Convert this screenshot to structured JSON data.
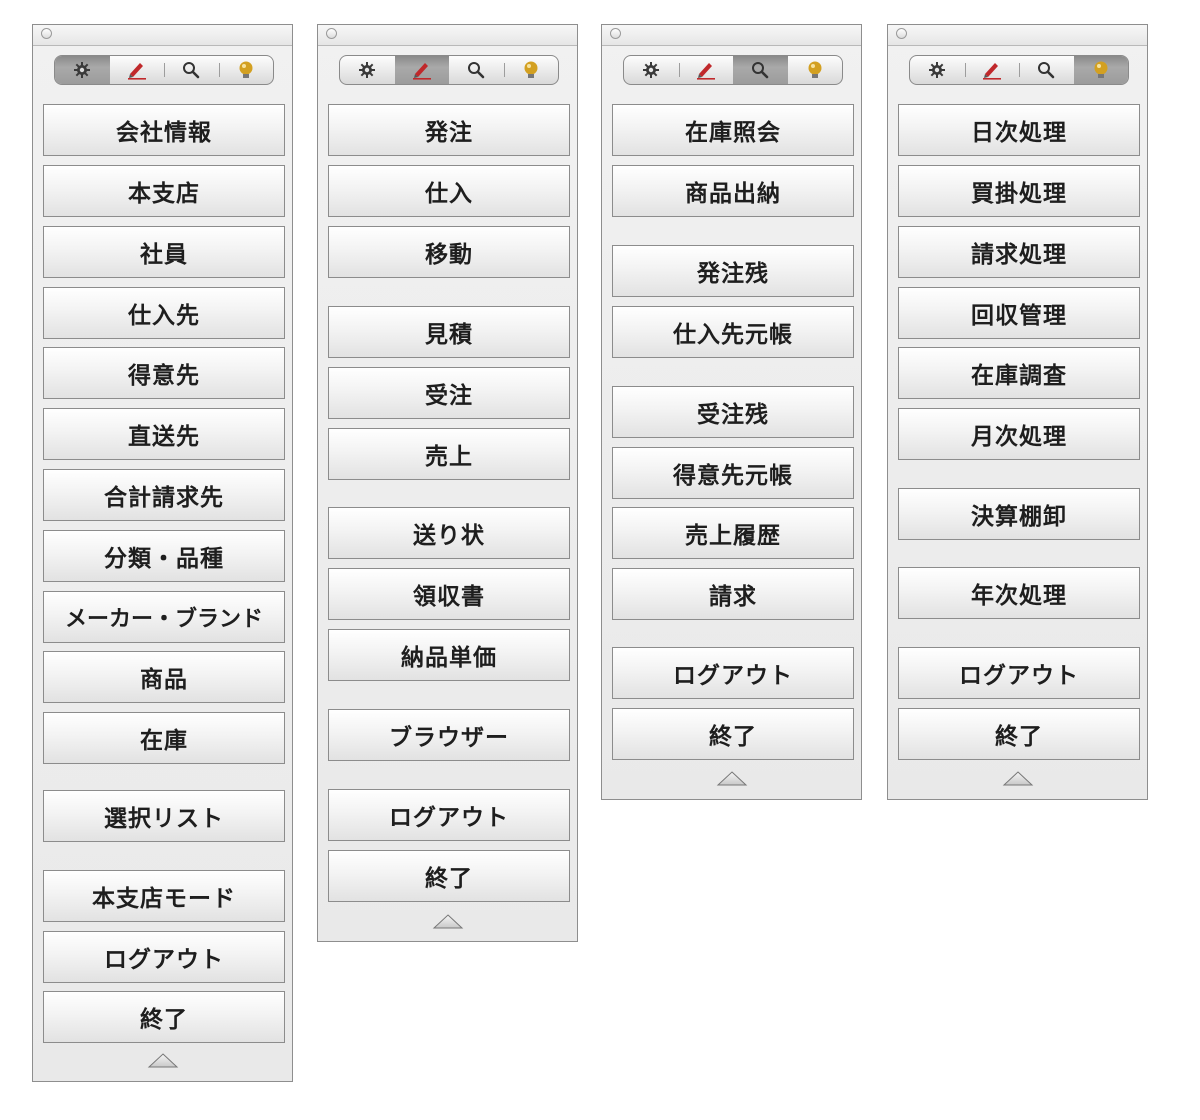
{
  "panels": [
    {
      "active_tab": "settings",
      "items": [
        "会社情報",
        "本支店",
        "社員",
        "仕入先",
        "得意先",
        "直送先",
        "合計請求先",
        "分類・品種",
        "メーカー・ブランド",
        "商品",
        "在庫",
        "選択リスト",
        "本支店モード",
        "ログアウト",
        "終了"
      ]
    },
    {
      "active_tab": "edit",
      "items": [
        "発注",
        "仕入",
        "移動",
        "見積",
        "受注",
        "売上",
        "送り状",
        "領収書",
        "納品単価",
        "ブラウザー",
        "ログアウト",
        "終了"
      ]
    },
    {
      "active_tab": "search",
      "items": [
        "在庫照会",
        "商品出納",
        "発注残",
        "仕入先元帳",
        "受注残",
        "得意先元帳",
        "売上履歴",
        "請求",
        "ログアウト",
        "終了"
      ]
    },
    {
      "active_tab": "tips",
      "items": [
        "日次処理",
        "買掛処理",
        "請求処理",
        "回収管理",
        "在庫調査",
        "月次処理",
        "決算棚卸",
        "年次処理",
        "ログアウト",
        "終了"
      ]
    }
  ],
  "tab_icons": [
    "gear-icon",
    "pencil-icon",
    "magnifier-icon",
    "lightbulb-icon"
  ],
  "colors": {
    "active_tab": "#999999",
    "pencil": "#c0282b",
    "bulb": "#d3a021",
    "panel_bg": "#ececec"
  }
}
